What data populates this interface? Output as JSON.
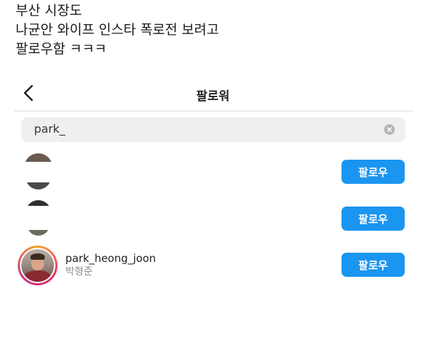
{
  "caption": {
    "lines": [
      "부산 시장도",
      "나균안 와이프 인스타 폭로전 보려고",
      "팔로우함 ㅋㅋㅋ"
    ]
  },
  "header": {
    "title": "팔로워"
  },
  "search": {
    "value": "park_"
  },
  "users": [
    {
      "username": "",
      "full_name": "",
      "button_label": "팔로우"
    },
    {
      "username": "",
      "full_name": "",
      "button_label": "팔로우"
    },
    {
      "username": "park_heong_joon",
      "full_name": "박형준",
      "button_label": "팔로우"
    }
  ],
  "colors": {
    "follow_button": "#1a95f0",
    "search_bg": "#efefef",
    "secondary_text": "#8e8e8e"
  },
  "icons": {
    "back": "chevron-left-icon",
    "clear": "clear-search-icon"
  }
}
